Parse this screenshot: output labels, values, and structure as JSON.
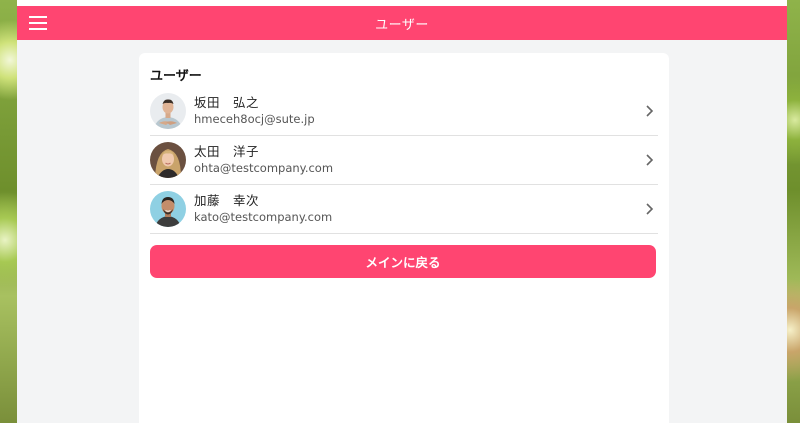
{
  "appbar": {
    "title": "ユーザー"
  },
  "card": {
    "heading": "ユーザー"
  },
  "users": [
    {
      "name": "坂田　弘之",
      "email": "hmeceh8ocj@sute.jp"
    },
    {
      "name": "太田　洋子",
      "email": "ohta@testcompany.com"
    },
    {
      "name": "加藤　幸次",
      "email": "kato@testcompany.com"
    }
  ],
  "actions": {
    "back_label": "メインに戻る"
  },
  "colors": {
    "accent": "#ff4571"
  },
  "icons": {
    "menu": "hamburger-menu-icon",
    "chevron": "chevron-right-icon"
  }
}
